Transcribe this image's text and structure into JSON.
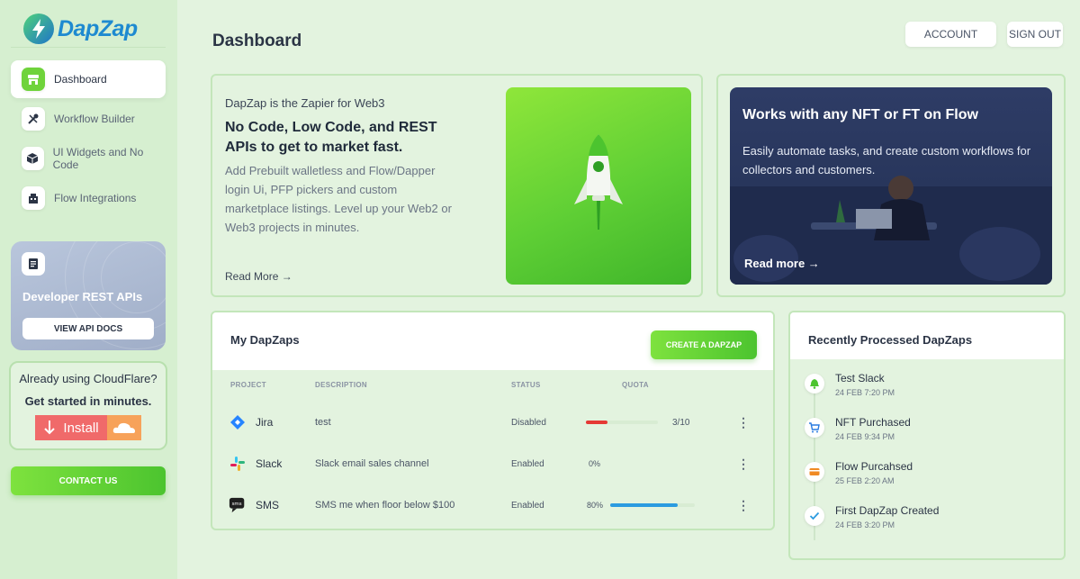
{
  "app": {
    "name": "DapZap"
  },
  "sidebar": {
    "items": [
      {
        "label": "Dashboard",
        "icon": "store-icon",
        "active": true
      },
      {
        "label": "Workflow Builder",
        "icon": "tools-icon",
        "active": false
      },
      {
        "label": "UI Widgets and No Code",
        "icon": "cube-icon",
        "active": false
      },
      {
        "label": "Flow Integrations",
        "icon": "building-icon",
        "active": false
      }
    ],
    "dev_card": {
      "title": "Developer REST APIs",
      "button": "VIEW API DOCS",
      "icon": "document-icon"
    },
    "cloudflare": {
      "line1": "Already using CloudFlare?",
      "line2": "Get started in minutes.",
      "install_label": "Install"
    },
    "contact_label": "CONTACT US"
  },
  "header": {
    "title": "Dashboard",
    "account_label": "ACCOUNT",
    "signout_label": "SIGN OUT"
  },
  "hero": {
    "kicker": "DapZap is the Zapier for Web3",
    "heading": "No Code, Low Code, and REST APIs to get to market fast.",
    "body": "Add Prebuilt walletless and Flow/Dapper login Ui, PFP pickers and custom marketplace listings. Level up your Web2 or Web3 projects in minutes.",
    "link": "Read More →"
  },
  "nft_card": {
    "title": "Works with any NFT or FT on Flow",
    "body": "Easily automate tasks, and create custom workflows for collectors and customers.",
    "link": "Read more →"
  },
  "dapzaps": {
    "title": "My DapZaps",
    "create_label": "CREATE A DAPZAP",
    "columns": {
      "project": "PROJECT",
      "description": "DESCRIPTION",
      "status": "STATUS",
      "quota": "QUOTA"
    },
    "rows": [
      {
        "project": "Jira",
        "icon": "jira-icon",
        "description": "test",
        "status": "Disabled",
        "quota_pct": "",
        "quota_fraction": 0.3,
        "quota_value": "3/10",
        "quota_color": "#e53935"
      },
      {
        "project": "Slack",
        "icon": "slack-icon",
        "description": "Slack email sales channel",
        "status": "Enabled",
        "quota_pct": "0%",
        "quota_fraction": 0,
        "quota_value": "",
        "quota_color": "#2b9be0"
      },
      {
        "project": "SMS",
        "icon": "sms-icon",
        "description": "SMS me when floor below $100",
        "status": "Enabled",
        "quota_pct": "80%",
        "quota_fraction": 0.8,
        "quota_value": "",
        "quota_color": "#2b9be0"
      }
    ]
  },
  "recent": {
    "title": "Recently Processed DapZaps",
    "events": [
      {
        "title": "Test Slack",
        "date": "24 FEB 7:20 PM",
        "icon": "bell-icon",
        "color": "#4cc42f"
      },
      {
        "title": "NFT Purchased",
        "date": "24 FEB 9:34 PM",
        "icon": "cart-icon",
        "color": "#2b7be0"
      },
      {
        "title": "Flow Purcahsed",
        "date": "25 FEB 2:20 AM",
        "icon": "card-icon",
        "color": "#f08a24"
      },
      {
        "title": "First DapZap Created",
        "date": "24 FEB 3:20 PM",
        "icon": "check-icon",
        "color": "#2b9be0"
      }
    ]
  },
  "colors": {
    "accent_green": "#5fcf35",
    "navy": "#27355a",
    "background": "#e3f3df"
  }
}
